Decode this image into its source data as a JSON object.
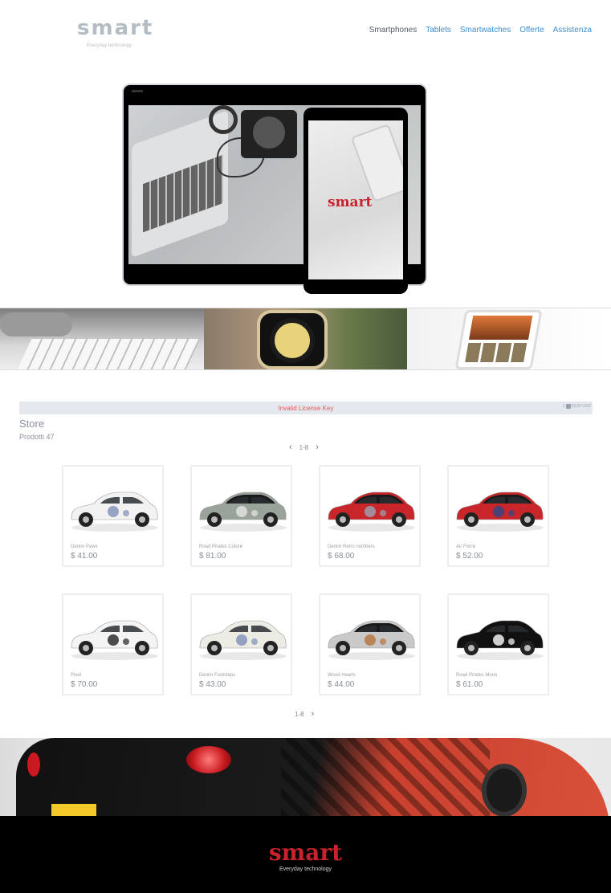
{
  "header": {
    "logo": "smart",
    "tagline": "Everyday technology",
    "nav": [
      "Smartphones",
      "Tablets",
      "Smartwatches",
      "Offerte",
      "Assistenza"
    ]
  },
  "hero": {
    "tablet_logo": "smart"
  },
  "license": {
    "message": "Invalid License Key",
    "cart_count": "1",
    "cart_total": "68,00 USD"
  },
  "store": {
    "title": "Store",
    "count": "Prodotti 47",
    "page_range": "1-8"
  },
  "products": [
    {
      "name": "Denim Paws",
      "price": "$ 41.00",
      "body": "#f2f2f2",
      "roof": "#f2f2f2",
      "decal": "#7f8fb6"
    },
    {
      "name": "Road Pirates Colore",
      "price": "$ 81.00",
      "body": "#9aa39a",
      "roof": "#1a1a1a",
      "decal": "#e5e5e5"
    },
    {
      "name": "Denim Retro numbers",
      "price": "$ 68.00",
      "body": "#c8262a",
      "roof": "#1a1a1a",
      "decal": "#9aa6b6"
    },
    {
      "name": "Air Force",
      "price": "$ 52.00",
      "body": "#c8262a",
      "roof": "#1a1a1a",
      "decal": "#2a4a8a"
    },
    {
      "name": "Pixel",
      "price": "$ 70.00",
      "body": "#f4f4f4",
      "roof": "#f4f4f4",
      "decal": "#222222"
    },
    {
      "name": "Denim Footsteps",
      "price": "$ 43.00",
      "body": "#ecebe4",
      "roof": "#ecebe4",
      "decal": "#7f8fb6"
    },
    {
      "name": "Wood Hearts",
      "price": "$ 44.00",
      "body": "#c9c9c9",
      "roof": "#1a1a1a",
      "decal": "#b5743c"
    },
    {
      "name": "Road Pirates Mono",
      "price": "$ 61.00",
      "body": "#111111",
      "roof": "#111111",
      "decal": "#ffffff"
    }
  ],
  "footer": {
    "logo": "smart",
    "tagline": "Everyday technology"
  }
}
